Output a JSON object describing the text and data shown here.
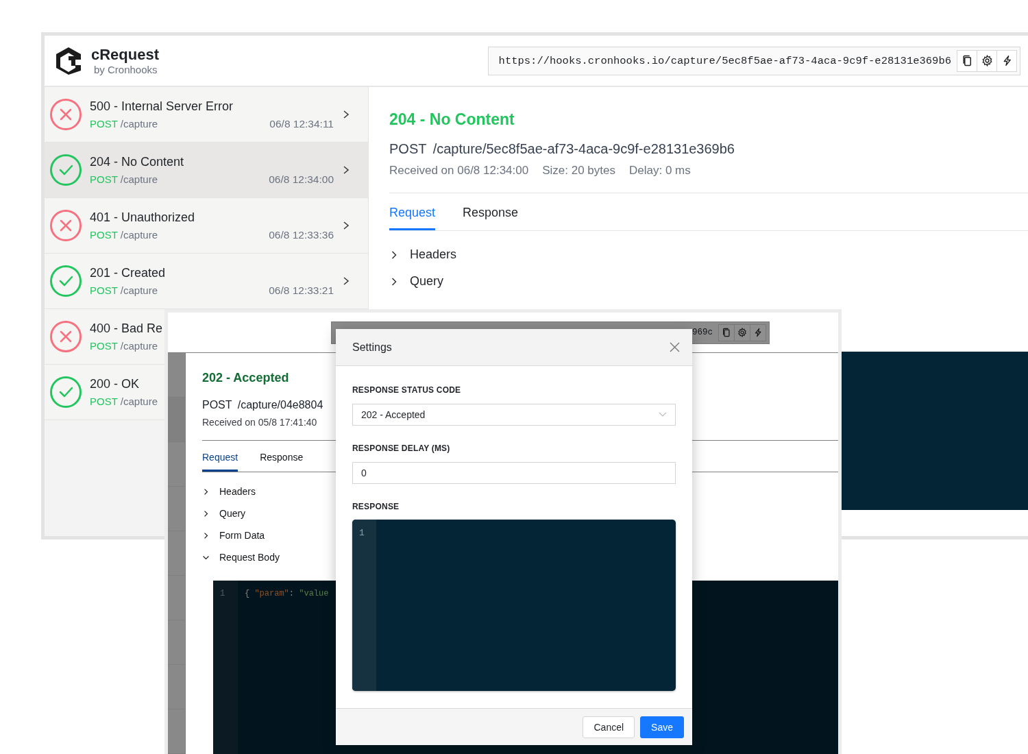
{
  "back_window": {
    "brand": {
      "name": "cRequest",
      "tagline": "by Cronhooks"
    },
    "url_field": {
      "value": "https://hooks.cronhooks.io/capture/5ec8f5ae-af73-4aca-9c9f-e28131e369b6"
    },
    "requests": [
      {
        "status": "500 - Internal Server Error",
        "kind": "error",
        "method": "POST",
        "path": "/capture",
        "time": "06/8 12:34:11",
        "selected": false
      },
      {
        "status": "204 - No Content",
        "kind": "success",
        "method": "POST",
        "path": "/capture",
        "time": "06/8 12:34:00",
        "selected": true
      },
      {
        "status": "401 - Unauthorized",
        "kind": "error",
        "method": "POST",
        "path": "/capture",
        "time": "06/8 12:33:36",
        "selected": false
      },
      {
        "status": "201 - Created",
        "kind": "success",
        "method": "POST",
        "path": "/capture",
        "time": "06/8 12:33:21",
        "selected": false
      },
      {
        "status": "400 - Bad Re",
        "kind": "error",
        "method": "POST",
        "path": "/capture",
        "selected": false
      },
      {
        "status": "200 - OK",
        "kind": "success",
        "method": "POST",
        "path": "/capture",
        "selected": false
      }
    ],
    "detail": {
      "title": "204 - No Content",
      "method": "POST",
      "path": "/capture/5ec8f5ae-af73-4aca-9c9f-e28131e369b6",
      "meta": [
        "Received on 06/8 12:34:00",
        "Size: 20 bytes",
        "Delay: 0 ms"
      ],
      "tabs": [
        {
          "label": "Request",
          "selected": true
        },
        {
          "label": "Response",
          "selected": false
        }
      ],
      "sections": [
        {
          "label": "Headers",
          "expanded": false
        },
        {
          "label": "Query",
          "expanded": false
        }
      ]
    }
  },
  "front_window": {
    "url_field": {
      "value": "969c"
    },
    "detail": {
      "title": "202 - Accepted",
      "method": "POST",
      "path": "/capture/04e8804",
      "meta": [
        "Received on 05/8 17:41:40"
      ],
      "tabs": [
        {
          "label": "Request",
          "selected": true
        },
        {
          "label": "Response",
          "selected": false
        }
      ],
      "sections": [
        {
          "label": "Headers",
          "expanded": false
        },
        {
          "label": "Query",
          "expanded": false
        },
        {
          "label": "Form Data",
          "expanded": false
        },
        {
          "label": "Request Body",
          "expanded": true
        }
      ],
      "request_body": {
        "line_number": "1",
        "tokens": [
          {
            "kind": "punct",
            "text": "{ "
          },
          {
            "kind": "key",
            "text": "\"param\""
          },
          {
            "kind": "punct",
            "text": ": "
          },
          {
            "kind": "string",
            "text": "\"value"
          }
        ]
      }
    }
  },
  "settings_dialog": {
    "title": "Settings",
    "fields": [
      {
        "kind": "select",
        "label": "RESPONSE STATUS CODE",
        "value": "202 - Accepted"
      },
      {
        "kind": "input",
        "label": "RESPONSE DELAY (MS)",
        "value": "0"
      },
      {
        "kind": "code",
        "label": "RESPONSE",
        "line_number": "1"
      }
    ],
    "buttons": [
      {
        "label": "Cancel",
        "kind": "secondary"
      },
      {
        "label": "Save",
        "kind": "primary"
      }
    ]
  }
}
